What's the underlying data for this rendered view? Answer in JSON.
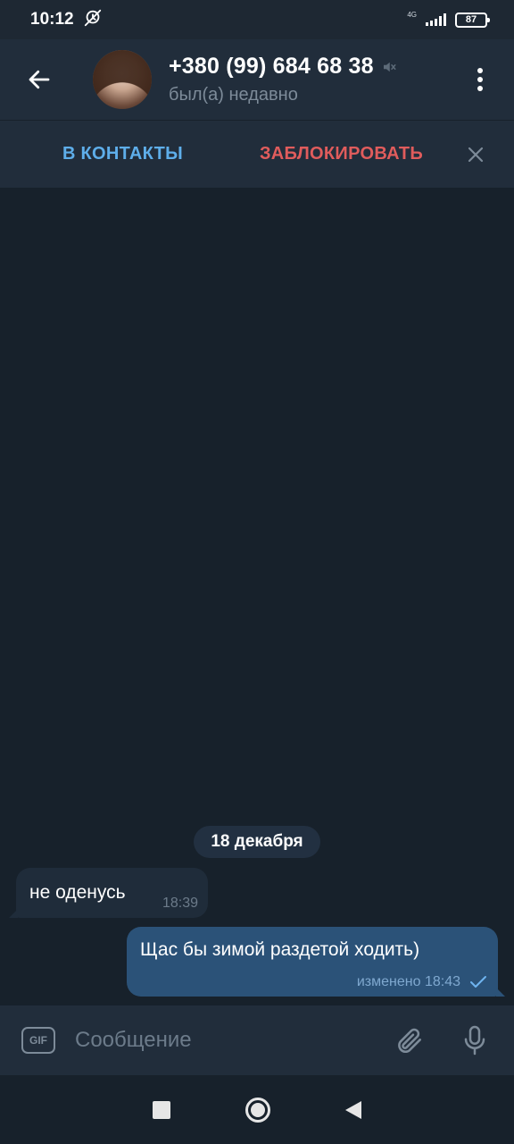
{
  "status_bar": {
    "time": "10:12",
    "network": "4G",
    "battery": "87",
    "icons": [
      "alarm-off-icon",
      "signal-icon",
      "battery-icon"
    ]
  },
  "header": {
    "contact_name": "+380 (99) 684 68 38",
    "status": "был(а) недавно",
    "muted": true
  },
  "action_bar": {
    "add_contact": "В КОНТАКТЫ",
    "block": "ЗАБЛОКИРОВАТЬ"
  },
  "chat": {
    "date_separator": "18 декабря",
    "messages": [
      {
        "direction": "incoming",
        "text": "не оденусь",
        "time": "18:39"
      },
      {
        "direction": "outgoing",
        "text": "Щас бы зимой раздетой ходить)",
        "edited_label": "изменено",
        "time": "18:43",
        "read": false
      }
    ]
  },
  "input_bar": {
    "gif_label": "GIF",
    "placeholder": "Сообщение"
  },
  "colors": {
    "background": "#17212b",
    "header": "#212d3b",
    "accent_blue": "#5eaeea",
    "danger_red": "#e05c5c",
    "outgoing_bubble": "#2b5278",
    "incoming_bubble": "#1f2c3a"
  }
}
